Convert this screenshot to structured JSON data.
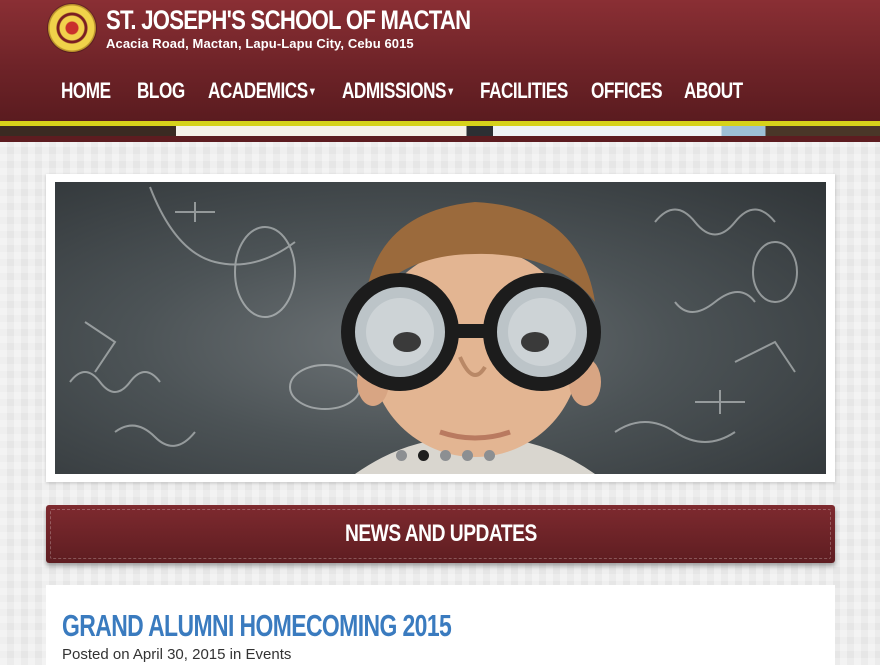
{
  "site": {
    "title": "ST. JOSEPH'S SCHOOL OF MACTAN",
    "address": "Acacia Road, Mactan, Lapu-Lapu City, Cebu 6015",
    "logo_icon": "school-seal-icon",
    "colors": {
      "maroon": "#6e2328",
      "accent_yellow": "#d6d21a",
      "link_blue": "#3a7bbf"
    }
  },
  "nav": {
    "items": [
      {
        "label": "HOME",
        "has_dropdown": false
      },
      {
        "label": "BLOG",
        "has_dropdown": false
      },
      {
        "label": "ACADEMICS",
        "has_dropdown": true
      },
      {
        "label": "ADMISSIONS",
        "has_dropdown": true
      },
      {
        "label": "FACILITIES",
        "has_dropdown": false
      },
      {
        "label": "OFFICES",
        "has_dropdown": false
      },
      {
        "label": "ABOUT",
        "has_dropdown": false
      }
    ],
    "caret": "▾"
  },
  "slider": {
    "slide_count": 5,
    "active_slide": 2,
    "image_icon": "boy-with-glasses-chalkboard-photo"
  },
  "news": {
    "heading": "NEWS AND UPDATES"
  },
  "post": {
    "title": "GRAND ALUMNI HOMECOMING 2015",
    "meta_prefix": "Posted on",
    "date": "April 30, 2015",
    "meta_mid": "in",
    "category": "Events"
  }
}
